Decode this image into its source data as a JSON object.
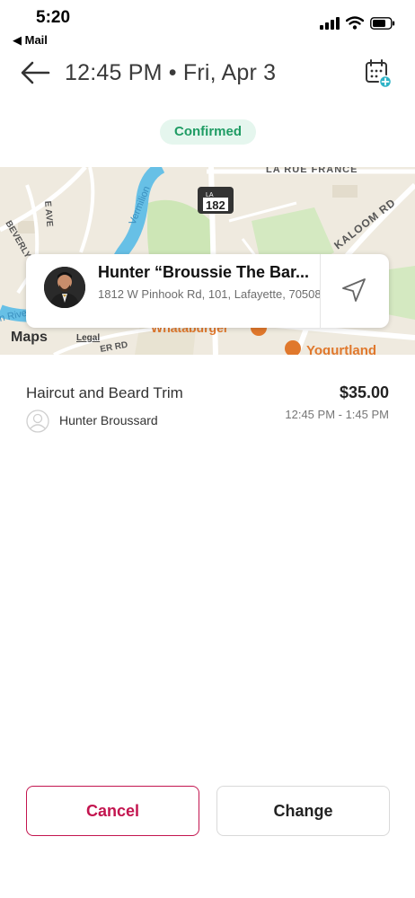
{
  "status_bar": {
    "time": "5:20",
    "back_app": "◀ Mail",
    "icons": [
      "signal-icon",
      "wifi-icon",
      "battery-icon"
    ]
  },
  "header": {
    "title": "12:45 PM • Fri, Apr 3",
    "icons": [
      "back-arrow-icon",
      "calendar-add-icon"
    ]
  },
  "status_badge": "Confirmed",
  "map": {
    "labels": {
      "road_top": "LA RUE FRANCE",
      "road_right": "KALOOM RD",
      "river": "Vermilion",
      "river_bottom": "n River",
      "street_left": "E AVE",
      "street_beverly": "BEVERLY DR",
      "road_bottom": "ER RD",
      "shield_state": "LA",
      "shield_number": "182",
      "poi_1": "Whataburger",
      "poi_2": "Yogurtland"
    },
    "logo": "Maps",
    "legal": "Legal"
  },
  "location_card": {
    "name": "Hunter “Broussie The Bar...",
    "address": "1812 W Pinhook Rd, 101, Lafayette, 70508"
  },
  "service": {
    "name": "Haircut and Beard Trim",
    "price": "$35.00",
    "staff": "Hunter Broussard",
    "time": "12:45 PM - 1:45 PM"
  },
  "actions": {
    "cancel": "Cancel",
    "change": "Change"
  },
  "colors": {
    "accent": "#c3154f",
    "confirmed_text": "#1f9c64",
    "confirmed_bg": "#e5f6ee"
  }
}
